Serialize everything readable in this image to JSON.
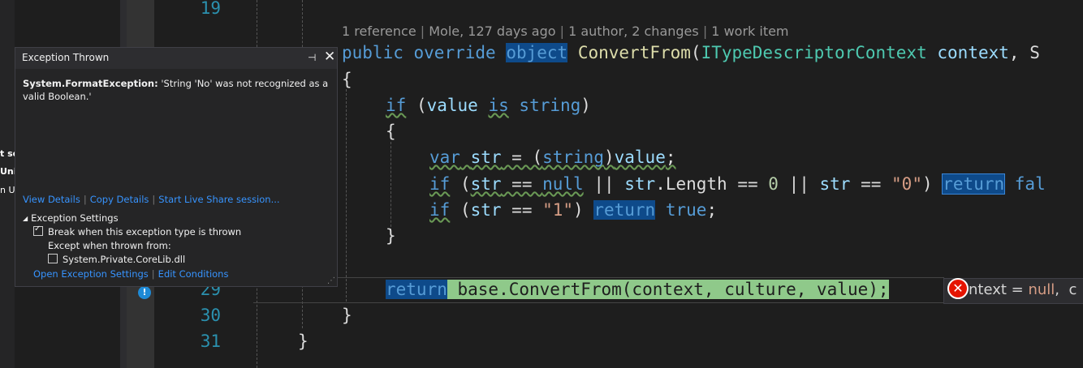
{
  "editor": {
    "line_numbers": [
      "19",
      "29",
      "30",
      "31"
    ],
    "codelens": {
      "references": "1 reference",
      "author_info": "Mole, 127 days ago",
      "changes": "1 author, 2 changes",
      "work_items": "1 work item"
    },
    "code": {
      "l1": {
        "kw1": "public",
        "kw2": "override",
        "kw3": "object",
        "method": "ConvertFrom",
        "p1": "(",
        "type": "ITypeDescriptorContext",
        "param": "context",
        "tail": ", S"
      },
      "l2": "{",
      "l3": {
        "kw": "if",
        "p1": " (",
        "v": "value",
        "kw2": "is",
        "type": "string",
        "p2": ")"
      },
      "l4": "{",
      "l5": {
        "kw": "var",
        "p1": " ",
        "v": "str",
        "p2": " = (",
        "type": "string",
        "p3": ")",
        "v2": "value",
        "p4": ";"
      },
      "l6": {
        "kw": "if",
        "p1": " (",
        "v": "str",
        "p2": " == ",
        "kw2": "null",
        "p3": " || ",
        "v2": "str",
        "p4": ".Length == ",
        "num": "0",
        "p5": " || ",
        "v3": "str",
        "p6": " == ",
        "str": "\"0\"",
        "p7": ") ",
        "kw3": "return",
        "p8": " ",
        "kw4": "fal"
      },
      "l7": {
        "kw": "if",
        "p1": " (",
        "v": "str",
        "p2": " == ",
        "str": "\"1\"",
        "p3": ") ",
        "kw2": "return",
        "p4": " ",
        "kw3": "true",
        "p5": ";"
      },
      "l8": "}",
      "l9": {
        "kw": "return",
        "rest": " base.ConvertFrom(context, culture, value);"
      },
      "l10": "}",
      "l11": "}"
    },
    "datatip": {
      "prefix": "ntext",
      "eq": " = ",
      "value": "null",
      "tail": ",  c"
    },
    "stray_labels": [
      "t se",
      "Unit",
      "n U"
    ]
  },
  "exception_popup": {
    "title": "Exception Thrown",
    "exception_type": "System.FormatException:",
    "message": "'String 'No' was not recognized as a valid Boolean.'",
    "links": {
      "view_details": "View Details",
      "copy_details": "Copy Details",
      "live_share": "Start Live Share session..."
    },
    "settings_header": "Exception Settings",
    "break_when_thrown": {
      "label": "Break when this exception type is thrown",
      "checked": true
    },
    "except_when_label": "Except when thrown from:",
    "corelib": {
      "label": "System.Private.CoreLib.dll",
      "checked": false
    },
    "bottom_links": {
      "open_settings": "Open Exception Settings",
      "edit_conditions": "Edit Conditions"
    }
  }
}
